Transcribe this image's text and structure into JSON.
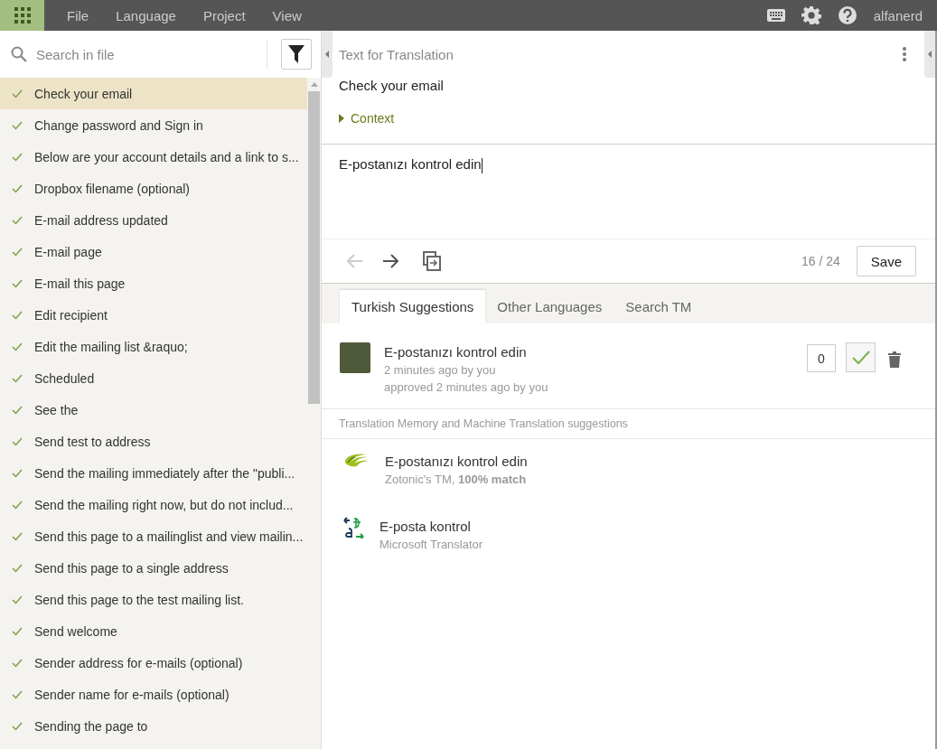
{
  "menu": [
    "File",
    "Language",
    "Project",
    "View"
  ],
  "user": "alfanerd",
  "search": {
    "placeholder": "Search in file"
  },
  "strings": [
    {
      "label": "Check your email",
      "translated": true,
      "selected": true
    },
    {
      "label": "Change password and Sign in",
      "translated": true,
      "selected": false
    },
    {
      "label": "Below are your account details and a link to s...",
      "translated": true,
      "selected": false
    },
    {
      "label": "Dropbox filename (optional)",
      "translated": true,
      "selected": false
    },
    {
      "label": "E-mail address updated",
      "translated": true,
      "selected": false
    },
    {
      "label": "E-mail page",
      "translated": true,
      "selected": false
    },
    {
      "label": "E-mail this page",
      "translated": true,
      "selected": false
    },
    {
      "label": "Edit recipient",
      "translated": true,
      "selected": false
    },
    {
      "label": "Edit the mailing list &raquo;",
      "translated": true,
      "selected": false
    },
    {
      "label": "Scheduled",
      "translated": true,
      "selected": false
    },
    {
      "label": "See the",
      "translated": true,
      "selected": false
    },
    {
      "label": "Send test to address",
      "translated": true,
      "selected": false
    },
    {
      "label": "Send the mailing immediately after the \"publi...",
      "translated": true,
      "selected": false
    },
    {
      "label": "Send the mailing right now, but do not includ...",
      "translated": true,
      "selected": false
    },
    {
      "label": "Send this page to a mailinglist and view mailin...",
      "translated": true,
      "selected": false
    },
    {
      "label": "Send this page to a single address",
      "translated": true,
      "selected": false
    },
    {
      "label": "Send this page to the test mailing list.",
      "translated": true,
      "selected": false
    },
    {
      "label": "Send welcome",
      "translated": true,
      "selected": false
    },
    {
      "label": "Sender address for e-mails (optional)",
      "translated": true,
      "selected": false
    },
    {
      "label": "Sender name for e-mails (optional)",
      "translated": true,
      "selected": false
    },
    {
      "label": "Sending the page to",
      "translated": true,
      "selected": false
    }
  ],
  "source": {
    "heading": "Text for Translation",
    "text": "Check your email",
    "context_label": "Context",
    "context_expanded": false
  },
  "translation": {
    "value": "E-postanızı kontrol edin"
  },
  "nav": {
    "previous_disabled": true,
    "next_disabled": false
  },
  "counter": "16 / 24",
  "save_button": "Save",
  "tabs": [
    {
      "label": "Turkish Suggestions",
      "selected": true
    },
    {
      "label": "Other Languages",
      "selected": false
    },
    {
      "label": "Search TM",
      "selected": false
    }
  ],
  "suggestions": [
    {
      "text": "E-postanızı kontrol edin",
      "meta": "2 minutes ago by you",
      "approval": "approved 2 minutes ago by you",
      "votes": "0",
      "approved": true
    }
  ],
  "machine_heading": "Translation Memory and Machine Translation suggestions",
  "machine_suggestions": [
    {
      "kind": "tm",
      "text": "E-postanızı kontrol edin",
      "source": "Zotonic's TM, **100% match**"
    },
    {
      "kind": "mt",
      "text": "E-posta kontrol",
      "source": "Microsoft Translator"
    }
  ]
}
